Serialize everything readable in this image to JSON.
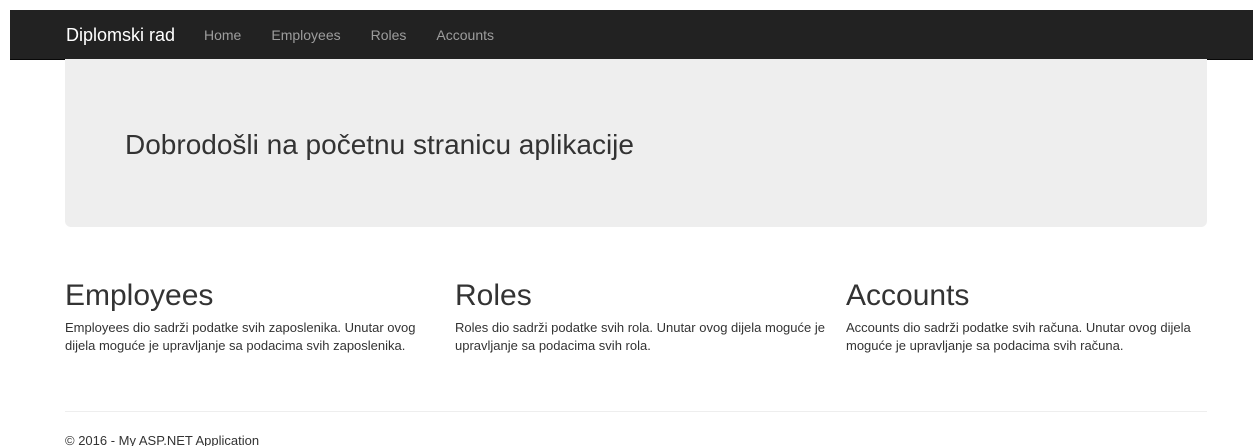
{
  "navbar": {
    "brand": "Diplomski rad",
    "items": [
      {
        "label": "Home"
      },
      {
        "label": "Employees"
      },
      {
        "label": "Roles"
      },
      {
        "label": "Accounts"
      }
    ]
  },
  "jumbotron": {
    "heading": "Dobrodošli na početnu stranicu aplikacije"
  },
  "sections": [
    {
      "title": "Employees",
      "text": "Employees dio sadrži podatke svih zaposlenika. Unutar ovog dijela moguće je upravljanje sa podacima svih zaposlenika."
    },
    {
      "title": "Roles",
      "text": "Roles dio sadrži podatke svih rola. Unutar ovog dijela moguće je upravljanje sa podacima svih rola."
    },
    {
      "title": "Accounts",
      "text": "Accounts dio sadrži podatke svih računa. Unutar ovog dijela moguće je upravljanje sa podacima svih računa."
    }
  ],
  "footer": {
    "text": "© 2016 - My ASP.NET Application"
  },
  "colors": {
    "navbar_bg": "#222222",
    "nav_link": "#9d9d9d",
    "brand": "#ffffff",
    "jumbotron_bg": "#eeeeee",
    "text": "#333333"
  }
}
